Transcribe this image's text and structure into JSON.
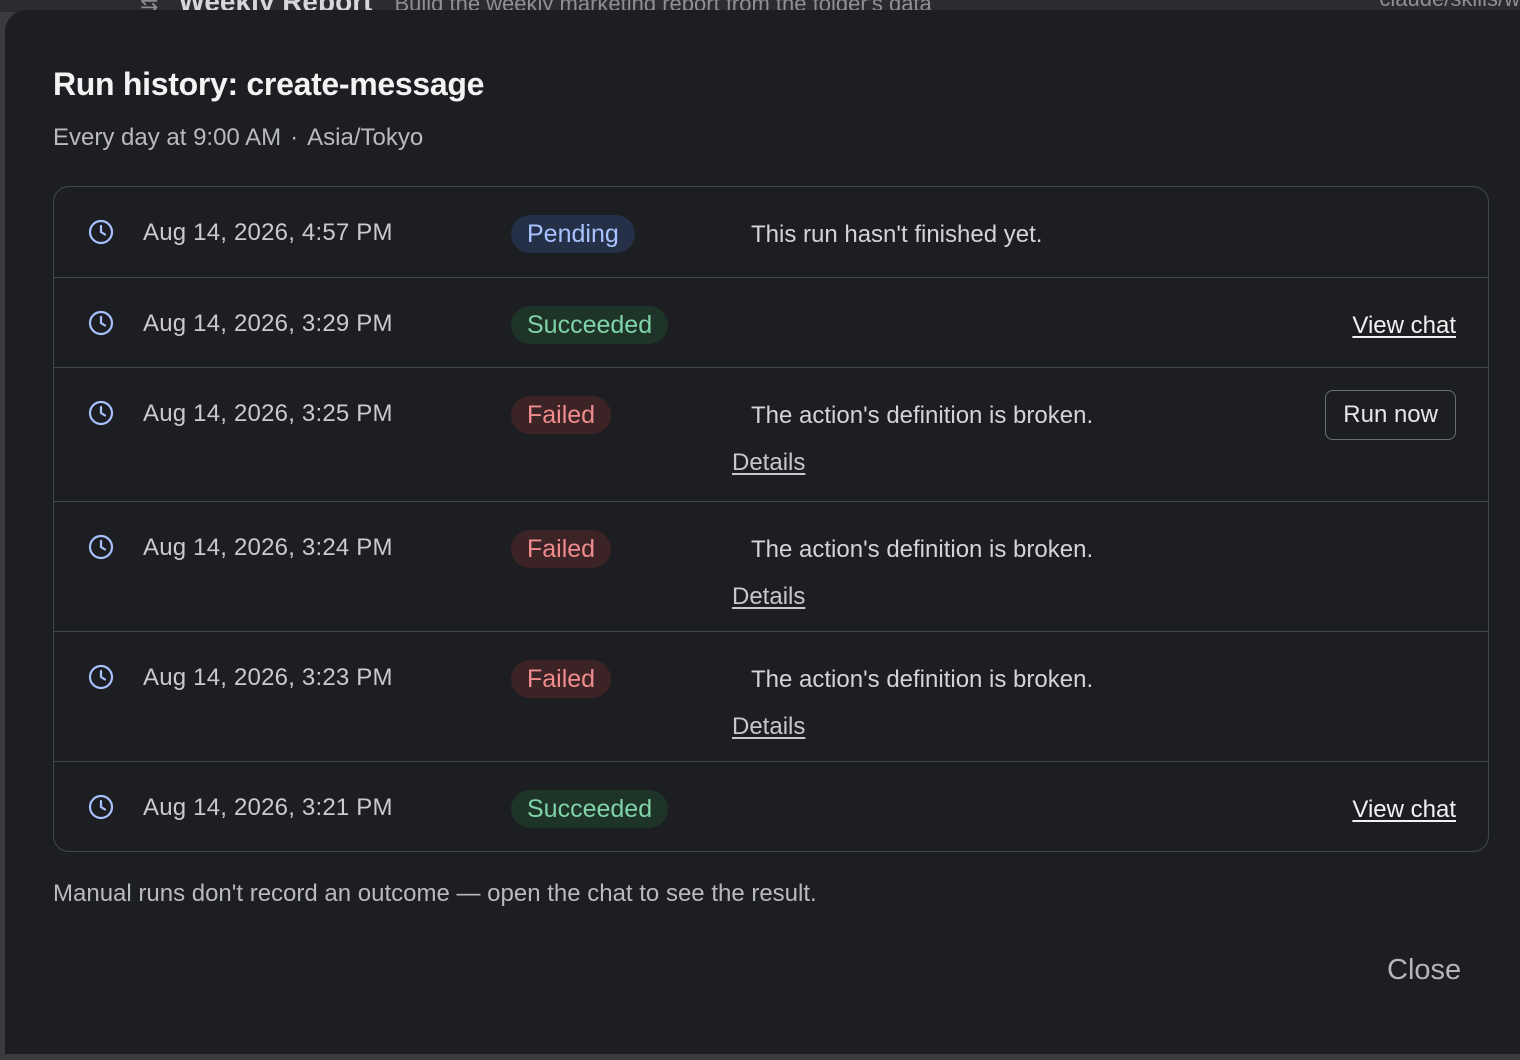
{
  "background": {
    "icon": "workflow-icon",
    "title": "Weekly Report",
    "description": "Build the weekly marketing report from the folder's data",
    "path": "claude/skills/w"
  },
  "dialog": {
    "title": "Run history: create-message",
    "schedule": "Every day at 9:00 AM",
    "separator": "·",
    "timezone": "Asia/Tokyo",
    "runs": [
      {
        "time": "Aug 14, 2026, 4:57 PM",
        "status": "Pending",
        "message": "This run hasn't finished yet."
      },
      {
        "time": "Aug 14, 2026, 3:29 PM",
        "status": "Succeeded",
        "action": "View chat"
      },
      {
        "time": "Aug 14, 2026, 3:25 PM",
        "status": "Failed",
        "message": "The action's definition is broken.",
        "details": "Details",
        "action": "Run now"
      },
      {
        "time": "Aug 14, 2026, 3:24 PM",
        "status": "Failed",
        "message": "The action's definition is broken.",
        "details": "Details"
      },
      {
        "time": "Aug 14, 2026, 3:23 PM",
        "status": "Failed",
        "message": "The action's definition is broken.",
        "details": "Details"
      },
      {
        "time": "Aug 14, 2026, 3:21 PM",
        "status": "Succeeded",
        "action": "View chat"
      }
    ],
    "footnote": "Manual runs don't record an outcome — open the chat to see the result.",
    "close_label": "Close"
  },
  "colors": {
    "dialog_bg": "#1c1e21",
    "pending": "#a9c2ff",
    "succeeded": "#7fd3a6",
    "failed": "#f08b8e",
    "clock_icon": "#a9c2ff"
  }
}
